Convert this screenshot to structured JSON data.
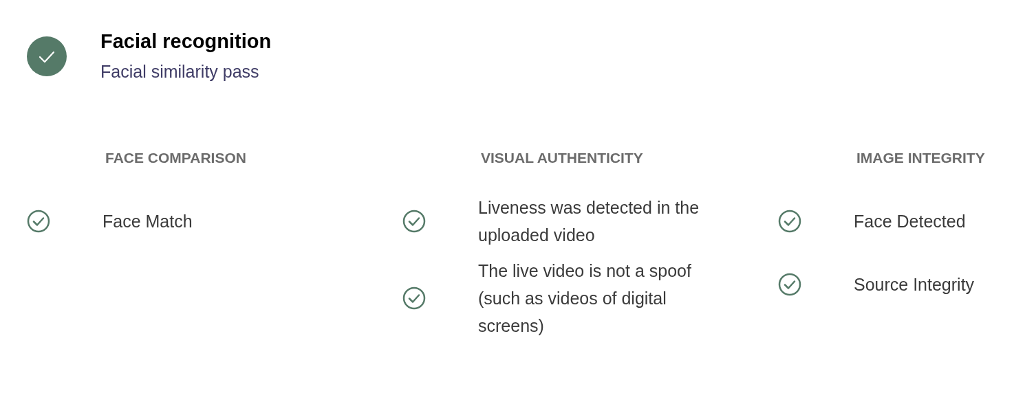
{
  "header": {
    "title": "Facial recognition",
    "subtitle": "Facial similarity pass"
  },
  "sections": [
    {
      "title": "FACE COMPARISON",
      "items": [
        {
          "label": "Face Match"
        }
      ]
    },
    {
      "title": "VISUAL AUTHENTICITY",
      "items": [
        {
          "label": "Liveness was detected in the uploaded video"
        },
        {
          "label": "The live video is not a spoof (such as videos of digital screens)"
        }
      ]
    },
    {
      "title": "IMAGE INTEGRITY",
      "items": [
        {
          "label": "Face Detected"
        },
        {
          "label": "Source Integrity"
        }
      ]
    }
  ]
}
